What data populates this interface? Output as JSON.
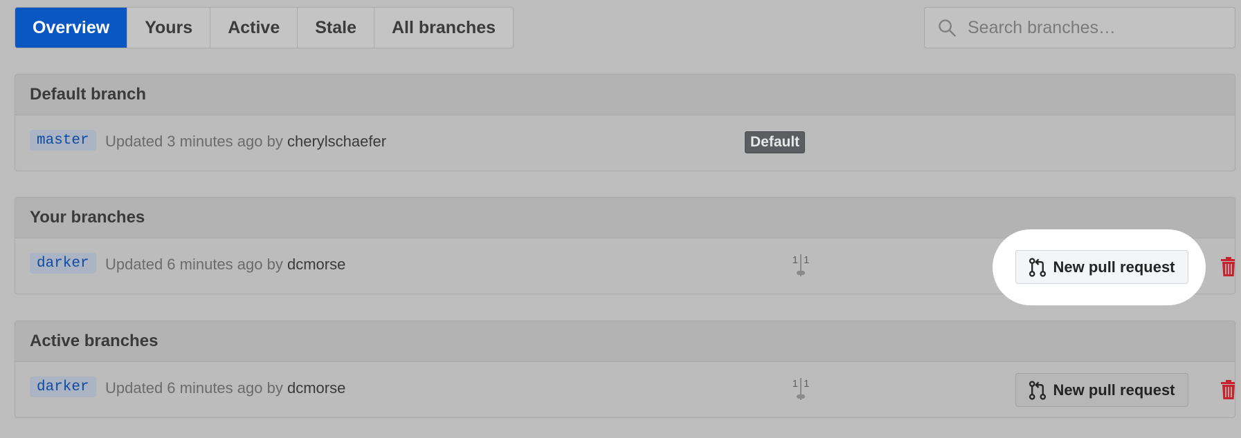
{
  "tabs": [
    {
      "label": "Overview",
      "selected": true
    },
    {
      "label": "Yours"
    },
    {
      "label": "Active"
    },
    {
      "label": "Stale"
    },
    {
      "label": "All branches"
    }
  ],
  "search": {
    "placeholder": "Search branches…",
    "icon": "search-icon"
  },
  "sections": {
    "default": {
      "title": "Default branch",
      "row": {
        "branch": "master",
        "updated": "Updated 3 minutes ago by",
        "author": "cherylschaefer",
        "badge": "Default"
      }
    },
    "yours": {
      "title": "Your branches",
      "row": {
        "branch": "darker",
        "updated": "Updated 6 minutes ago by",
        "author": "dcmorse",
        "behind": "1",
        "ahead": "1",
        "pr_label": "New pull request"
      }
    },
    "active": {
      "title": "Active branches",
      "row": {
        "branch": "darker",
        "updated": "Updated 6 minutes ago by",
        "author": "dcmorse",
        "behind": "1",
        "ahead": "1",
        "pr_label": "New pull request"
      }
    }
  },
  "colors": {
    "accent": "#0b57c2",
    "delete": "#c4242e",
    "highlight": "#ffffff"
  }
}
